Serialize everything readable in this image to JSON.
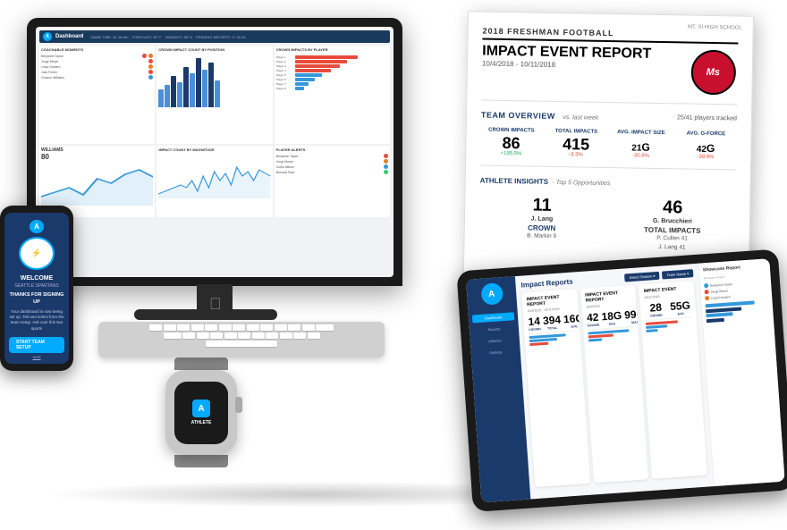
{
  "report": {
    "year_tag": "2018 FRESHMAN FOOTBALL",
    "title": "IMPACT EVENT REPORT",
    "date_range": "10/4/2018 - 10/11/2018",
    "school": "MT. SI HIGH SCHOOL",
    "team_overview_label": "TEAM OVERVIEW",
    "vs_label": "vs. last week",
    "players_tracked": "25/41 players tracked",
    "stats": [
      {
        "label": "CROWN IMPACTS",
        "value": "86",
        "change": "+195.5%",
        "positive": true
      },
      {
        "label": "TOTAL IMPACTS",
        "value": "415",
        "change": "-3.3%",
        "positive": false
      },
      {
        "label": "AVG. IMPACT SIZE",
        "value": "21",
        "unit": "G",
        "change": "-30.8%",
        "positive": false
      },
      {
        "label": "AVG. G-FORCE",
        "value": "42",
        "unit": "G",
        "change": "-30.8%",
        "positive": false
      }
    ],
    "insights_title": "ATHLETE INSIGHTS",
    "insights_sub": "- Top 5 Opportunities",
    "crown_value": "11",
    "crown_name": "J. Lang",
    "crown_label": "CROWN",
    "crown_runner": "B. Markin  9",
    "total_value": "46",
    "total_name": "G. Brucchieri",
    "total_label": "TOTAL IMPACTS",
    "total_list": [
      "P. Cullen  41",
      "J. Lang  41"
    ]
  },
  "dashboard": {
    "title": "Dashboard",
    "nav_items": [
      "GAME TIME: 2h 38 min",
      "FORECAST: 39° F",
      "HUMIDITY: 88 %",
      "PENDING IMPORTS: 17  30  24"
    ],
    "sections": {
      "coachable_moments": "COACHABLE MOMENTS",
      "crown_impact_by_position": "CROWN IMPACT COUNT BY POSITION",
      "crown_impacts_by_player": "CROWN IMPACTS BY PLAYER",
      "impact_count_by_magnitude": "IMPACT COUNT BY MAGNITUDE",
      "player_alerts": "PLAYER ALERTS"
    },
    "players": [
      {
        "name": "Benjamin Taylor",
        "status": "red"
      },
      {
        "name": "Jorge Meyer",
        "status": "red"
      },
      {
        "name": "Lloyd Howard",
        "status": "orange"
      },
      {
        "name": "Jack Fisher",
        "status": "red"
      },
      {
        "name": "Chance Williams",
        "status": "blue"
      }
    ],
    "williams_label": "WILLIAMS",
    "williams_value": "80"
  },
  "phone": {
    "logo": "A",
    "welcome": "WELCOME",
    "subtitle": "SEATTLE SPARTANS",
    "thanks": "THANKS FOR SIGNING UP",
    "body_text": "Your dashboard is now being set up. Tell and select from the team setup. Ask over this two sports",
    "cta_primary": "START TEAM SETUP",
    "cta_secondary": "SKIP"
  },
  "watch": {
    "logo": "A",
    "text": "ATHLETE"
  },
  "tablet": {
    "title": "Impact Reports",
    "logo": "A",
    "nav_items": [
      "Dashboard",
      "Reports",
      "Athletes",
      "Settings"
    ],
    "controls": [
      "Select Season ▾",
      "Team Name ▾"
    ],
    "right_panel_title": "Showcase Report",
    "report_cards": [
      {
        "title": "IMPACT EVENT REPORT",
        "date": "10/4/2018 - 10/11/2018",
        "stat1": "14",
        "stat2": "394",
        "stat3": "16G"
      },
      {
        "title": "IMPACT EVENT REPORT",
        "date": "10/4/2018",
        "stat1": "42",
        "stat2": "18G",
        "stat3": "99G"
      },
      {
        "title": "IMPACT EVENT",
        "date": "10/11/2018",
        "stat1": "28",
        "stat2": "55G",
        "stat3": ""
      }
    ]
  }
}
